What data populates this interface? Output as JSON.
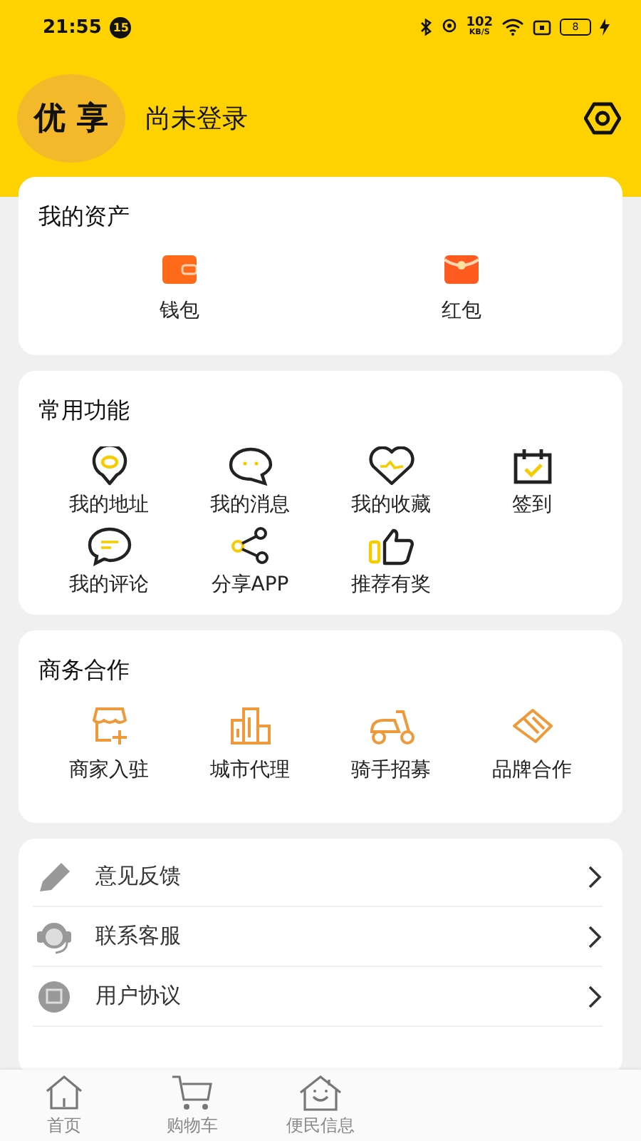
{
  "status_bar": {
    "time": "21:55",
    "notification_count": "15",
    "net_speed_value": "102",
    "net_speed_unit": "KB/S",
    "battery": "8"
  },
  "header": {
    "avatar_text": "优 享",
    "login_status": "尚未登录"
  },
  "assets": {
    "title": "我的资产",
    "items": [
      {
        "label": "钱包",
        "kind": "wallet"
      },
      {
        "label": "红包",
        "kind": "redpacket"
      }
    ]
  },
  "functions": {
    "title": "常用功能",
    "items": [
      {
        "label": "我的地址",
        "kind": "location"
      },
      {
        "label": "我的消息",
        "kind": "message"
      },
      {
        "label": "我的收藏",
        "kind": "heart"
      },
      {
        "label": "签到",
        "kind": "calendar"
      },
      {
        "label": "我的评论",
        "kind": "comment"
      },
      {
        "label": "分享APP",
        "kind": "share"
      },
      {
        "label": "推荐有奖",
        "kind": "thumb"
      }
    ]
  },
  "business": {
    "title": "商务合作",
    "items": [
      {
        "label": "商家入驻",
        "kind": "shop"
      },
      {
        "label": "城市代理",
        "kind": "building"
      },
      {
        "label": "骑手招募",
        "kind": "scooter"
      },
      {
        "label": "品牌合作",
        "kind": "handshake"
      }
    ]
  },
  "menu": [
    {
      "label": "意见反馈",
      "kind": "pencil"
    },
    {
      "label": "联系客服",
      "kind": "headset"
    },
    {
      "label": "用户协议",
      "kind": "document"
    }
  ],
  "tab_bar": [
    {
      "label": "首页",
      "kind": "home",
      "selected": false
    },
    {
      "label": "购物车",
      "kind": "cart",
      "selected": false
    },
    {
      "label": "便民信息",
      "kind": "house",
      "selected": false
    }
  ]
}
